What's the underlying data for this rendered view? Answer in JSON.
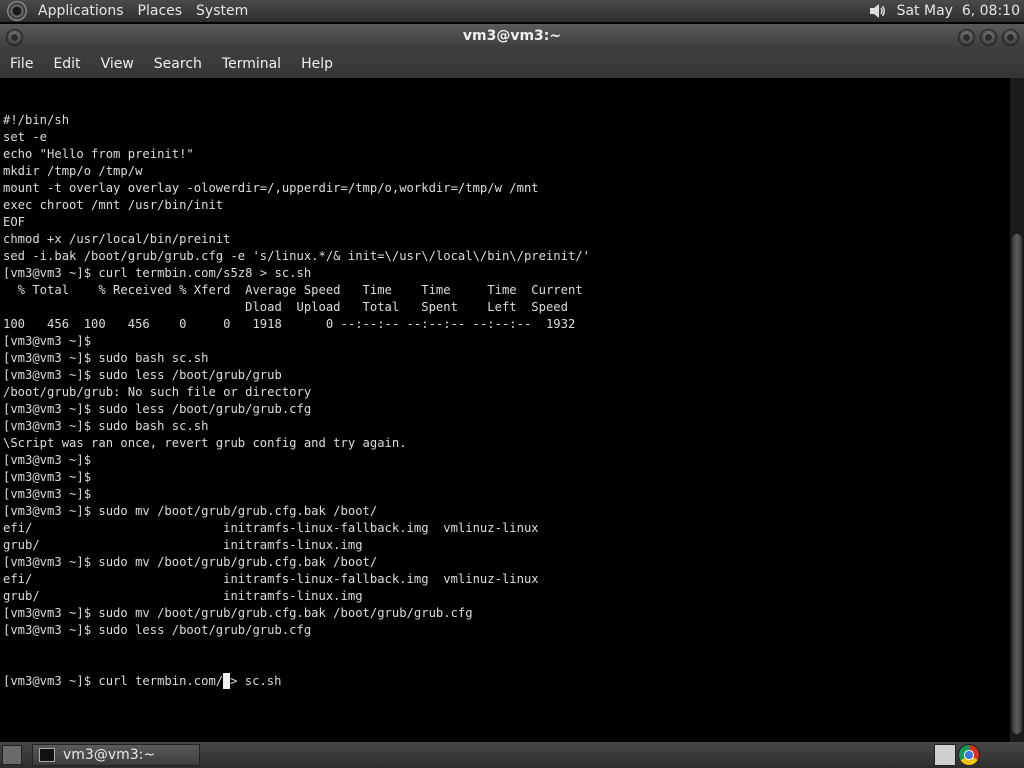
{
  "top_panel": {
    "menus": [
      "Applications",
      "Places",
      "System"
    ],
    "clock": "Sat May  6, 08:10"
  },
  "window": {
    "title": "vm3@vm3:~"
  },
  "menubar": [
    "File",
    "Edit",
    "View",
    "Search",
    "Terminal",
    "Help"
  ],
  "terminal": {
    "lines": [
      "#!/bin/sh",
      "set -e",
      "echo \"Hello from preinit!\"",
      "mkdir /tmp/o /tmp/w",
      "mount -t overlay overlay -olowerdir=/,upperdir=/tmp/o,workdir=/tmp/w /mnt",
      "exec chroot /mnt /usr/bin/init",
      "EOF",
      "chmod +x /usr/local/bin/preinit",
      "sed -i.bak /boot/grub/grub.cfg -e 's/linux.*/& init=\\/usr\\/local\\/bin\\/preinit/'",
      "[vm3@vm3 ~]$ curl termbin.com/s5z8 > sc.sh",
      "  % Total    % Received % Xferd  Average Speed   Time    Time     Time  Current",
      "                                 Dload  Upload   Total   Spent    Left  Speed",
      "100   456  100   456    0     0   1918      0 --:--:-- --:--:-- --:--:--  1932",
      "[vm3@vm3 ~]$",
      "[vm3@vm3 ~]$ sudo bash sc.sh",
      "[vm3@vm3 ~]$ sudo less /boot/grub/grub",
      "/boot/grub/grub: No such file or directory",
      "[vm3@vm3 ~]$ sudo less /boot/grub/grub.cfg",
      "[vm3@vm3 ~]$ sudo bash sc.sh",
      "\\Script was ran once, revert grub config and try again.",
      "[vm3@vm3 ~]$",
      "[vm3@vm3 ~]$",
      "[vm3@vm3 ~]$",
      "[vm3@vm3 ~]$ sudo mv /boot/grub/grub.cfg.bak /boot/",
      "efi/                          initramfs-linux-fallback.img  vmlinuz-linux",
      "grub/                         initramfs-linux.img",
      "[vm3@vm3 ~]$ sudo mv /boot/grub/grub.cfg.bak /boot/",
      "efi/                          initramfs-linux-fallback.img  vmlinuz-linux",
      "grub/                         initramfs-linux.img",
      "[vm3@vm3 ~]$ sudo mv /boot/grub/grub.cfg.bak /boot/grub/grub.cfg",
      "[vm3@vm3 ~]$ sudo less /boot/grub/grub.cfg"
    ],
    "prompt_before_cursor": "[vm3@vm3 ~]$ curl termbin.com/",
    "prompt_after_cursor": "> sc.sh"
  },
  "taskbar": {
    "task_label": "vm3@vm3:~"
  },
  "icons": {
    "logo": "distro-logo-icon",
    "volume": "volume-icon",
    "terminal_task": "terminal-icon",
    "tray_terminal": "terminal-icon",
    "tray_browser": "chrome-icon"
  }
}
